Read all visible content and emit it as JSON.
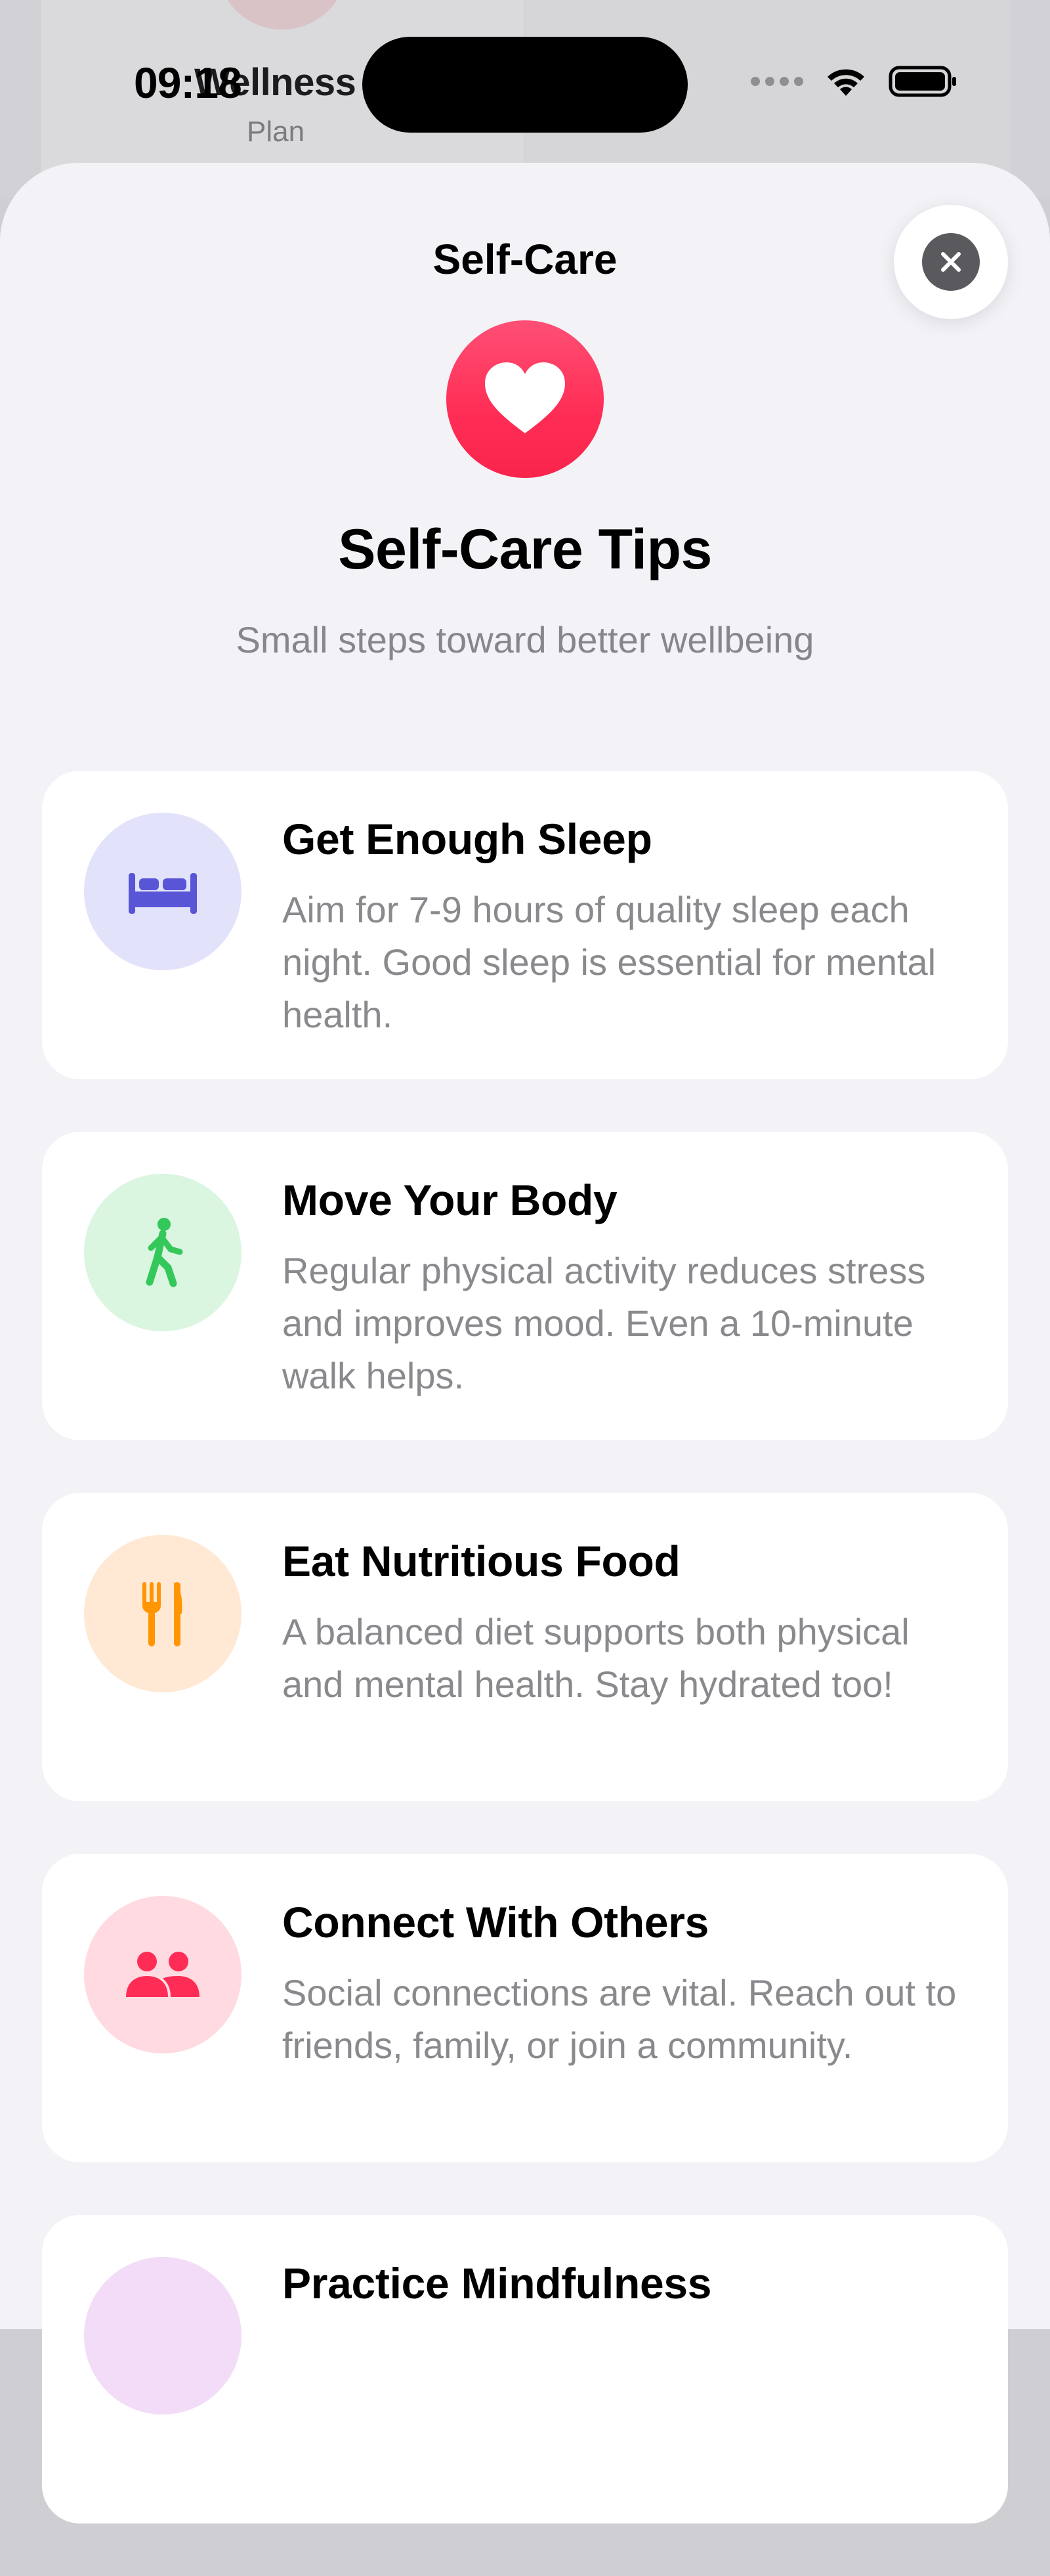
{
  "status_bar": {
    "time": "09:18"
  },
  "background_page": {
    "title": "Wellness",
    "subtitle": "Plan"
  },
  "sheet": {
    "title": "Self-Care",
    "hero_title": "Self-Care Tips",
    "hero_subtitle": "Small steps toward better wellbeing"
  },
  "tips": [
    {
      "title": "Get Enough Sleep",
      "description": "Aim for 7-9 hours of quality sleep each night. Good sleep is essential for mental health.",
      "icon": "bed-icon",
      "icon_color": "#5856d6",
      "bg_color": "#e3e2fb"
    },
    {
      "title": "Move Your Body",
      "description": "Regular physical activity reduces stress and improves mood. Even a 10-minute walk helps.",
      "icon": "walking-figure-icon",
      "icon_color": "#34c759",
      "bg_color": "#daf5e0"
    },
    {
      "title": "Eat Nutritious Food",
      "description": "A balanced diet supports both physical and mental health. Stay hydrated too!",
      "icon": "fork-knife-icon",
      "icon_color": "#ff9500",
      "bg_color": "#ffe9d4"
    },
    {
      "title": "Connect With Others",
      "description": "Social connections are vital. Reach out to friends, family, or join a community.",
      "icon": "people-icon",
      "icon_color": "#ff2d55",
      "bg_color": "#ffdae1"
    },
    {
      "title": "Practice Mindfulness",
      "description": "",
      "icon": "mindfulness-icon",
      "icon_color": "#af52de",
      "bg_color": "#f2dcf8"
    }
  ],
  "colors": {
    "accent": "#ff2d55",
    "sheet_background": "#f2f2f7",
    "card_background": "#ffffff"
  }
}
